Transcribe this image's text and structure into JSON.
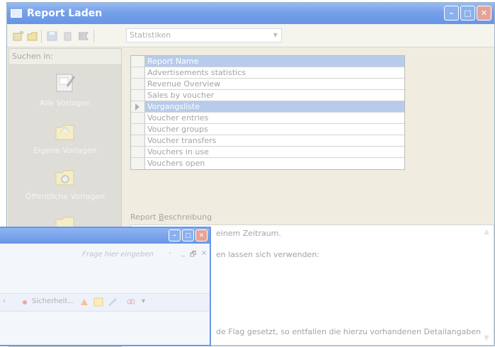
{
  "main_window": {
    "title": "Report Laden",
    "toolbar": {
      "selected_category": "Statistiken"
    },
    "left_pane": {
      "header": "Suchen in:",
      "items": [
        {
          "label": "Alle Vorlagen",
          "icon": "document-pen-icon"
        },
        {
          "label": "Eigene Vorlagen",
          "icon": "folder-icon"
        },
        {
          "label": "Öffentliche Vorlagen",
          "icon": "shared-folder-icon"
        },
        {
          "label": "",
          "icon": "folder-star-icon"
        }
      ]
    },
    "report_list": {
      "header": "Report Name",
      "rows": [
        "Advertisements statistics",
        "Revenue Overview",
        "Sales by voucher",
        "Vorgangsliste",
        "Voucher entries",
        "Voucher groups",
        "Voucher transfers",
        "Vouchers in use",
        "Vouchers open"
      ],
      "selected_row": "Vorgangsliste"
    },
    "description": {
      "label_pre": "Report ",
      "label_accel": "B",
      "label_post": "eschreibung",
      "lines": [
        "einem Zeitraum.",
        "en lassen sich verwenden:",
        "de Flag gesetzt, so entfallen die hierzu vorhandenen Detailangaben"
      ]
    }
  },
  "overlay_window": {
    "ask_placeholder": "Frage hier eingeben",
    "controls": [
      "-",
      "_",
      "×"
    ],
    "toolbar": {
      "security_label": "Sicherheit..."
    }
  },
  "colors": {
    "title_bar": "#3f79e0",
    "selection": "#a4bde6",
    "pane": "#d6d4ce"
  }
}
